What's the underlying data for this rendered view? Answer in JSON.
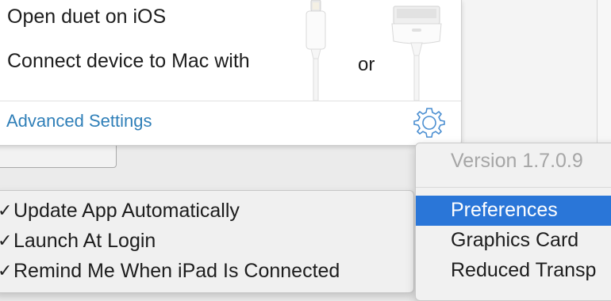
{
  "connect_popup": {
    "open_instruction": "Open duet on iOS",
    "connect_instruction": "Connect device to Mac with",
    "or_text": "or",
    "advanced_link": "Advanced Settings",
    "icons": {
      "gear": "gear-icon",
      "lightning_cable": "lightning-cable-icon",
      "dock_cable": "30-pin-cable-icon"
    }
  },
  "checkbox_menu": {
    "items": [
      {
        "label": "Update App Automatically",
        "checked": true,
        "check_glyph": "✓"
      },
      {
        "label": "Launch At Login",
        "checked": true,
        "check_glyph": "✓"
      },
      {
        "label": "Remind Me When iPad Is Connected",
        "checked": true,
        "check_glyph": "✓"
      }
    ]
  },
  "context_menu": {
    "version": "Version 1.7.0.9",
    "items": [
      {
        "label": "Preferences",
        "highlighted": true
      },
      {
        "label": "Graphics Card",
        "highlighted": false
      },
      {
        "label": "Reduced Transp",
        "highlighted": false
      }
    ]
  },
  "colors": {
    "link": "#2f7fb8",
    "highlight": "#2a76d8",
    "disabled_text": "#a6a6a6"
  }
}
